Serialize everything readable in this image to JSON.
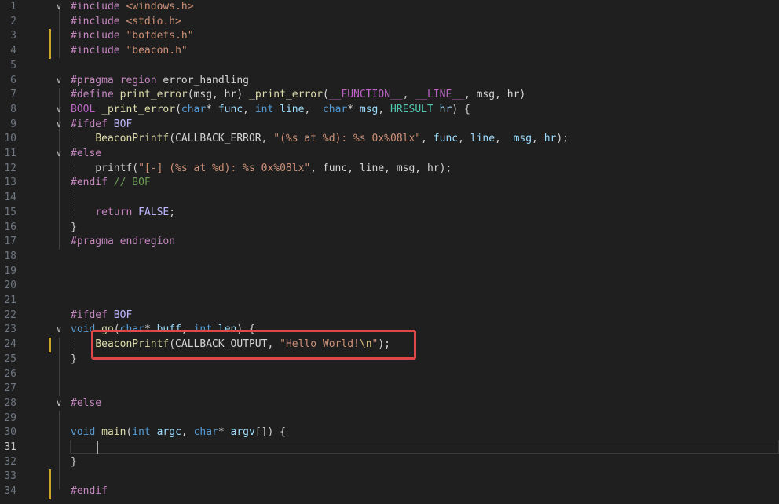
{
  "editor": {
    "active_line": 31,
    "colors": {
      "background": "#1f1f1f",
      "highlight_box": "#e04848",
      "modified_gutter": "#c8a628"
    },
    "lines": [
      {
        "n": "1",
        "fold": "v",
        "tokens": [
          {
            "t": "#include ",
            "c": "pp"
          },
          {
            "t": "<windows.h>",
            "c": "str"
          }
        ]
      },
      {
        "n": "2",
        "fold": "",
        "tokens": [
          {
            "t": "#include ",
            "c": "pp"
          },
          {
            "t": "<stdio.h>",
            "c": "str"
          }
        ]
      },
      {
        "n": "3",
        "fold": "",
        "mod": true,
        "tokens": [
          {
            "t": "#include ",
            "c": "pp"
          },
          {
            "t": "\"bofdefs.h\"",
            "c": "str"
          }
        ]
      },
      {
        "n": "4",
        "fold": "",
        "mod": true,
        "tokens": [
          {
            "t": "#include ",
            "c": "pp"
          },
          {
            "t": "\"beacon.h\"",
            "c": "str"
          }
        ]
      },
      {
        "n": "5",
        "fold": "",
        "tokens": []
      },
      {
        "n": "6",
        "fold": "v",
        "tokens": [
          {
            "t": "#pragma ",
            "c": "pp"
          },
          {
            "t": "region ",
            "c": "pp"
          },
          {
            "t": "error_handling",
            "c": "txt"
          }
        ]
      },
      {
        "n": "7",
        "fold": "",
        "tokens": [
          {
            "t": "#define ",
            "c": "pp"
          },
          {
            "t": "print_error",
            "c": "fn"
          },
          {
            "t": "(msg, hr) ",
            "c": "txt"
          },
          {
            "t": "_print_error",
            "c": "fn"
          },
          {
            "t": "(",
            "c": "txt"
          },
          {
            "t": "__FUNCTION__",
            "c": "mac"
          },
          {
            "t": ", ",
            "c": "txt"
          },
          {
            "t": "__LINE__",
            "c": "mac"
          },
          {
            "t": ", msg, hr)",
            "c": "txt"
          }
        ]
      },
      {
        "n": "8",
        "fold": "v",
        "tokens": [
          {
            "t": "BOOL ",
            "c": "mac"
          },
          {
            "t": "_print_error",
            "c": "fn"
          },
          {
            "t": "(",
            "c": "txt"
          },
          {
            "t": "char",
            "c": "kw"
          },
          {
            "t": "* ",
            "c": "txt"
          },
          {
            "t": "func",
            "c": "par"
          },
          {
            "t": ", ",
            "c": "txt"
          },
          {
            "t": "int ",
            "c": "kw"
          },
          {
            "t": "line",
            "c": "par"
          },
          {
            "t": ",  ",
            "c": "txt"
          },
          {
            "t": "char",
            "c": "kw"
          },
          {
            "t": "* ",
            "c": "txt"
          },
          {
            "t": "msg",
            "c": "par"
          },
          {
            "t": ", ",
            "c": "txt"
          },
          {
            "t": "HRESULT ",
            "c": "ty"
          },
          {
            "t": "hr",
            "c": "par"
          },
          {
            "t": ") {",
            "c": "txt"
          }
        ]
      },
      {
        "n": "9",
        "fold": "v",
        "tokens": [
          {
            "t": "#ifdef ",
            "c": "pp"
          },
          {
            "t": "BOF",
            "c": "mv"
          }
        ]
      },
      {
        "n": "10",
        "fold": "",
        "tokens": [
          {
            "t": "    ",
            "c": "txt"
          },
          {
            "t": "BeaconPrintf",
            "c": "fn"
          },
          {
            "t": "(CALLBACK_ERROR, ",
            "c": "txt"
          },
          {
            "t": "\"(%s at %d): %s 0x%08lx\"",
            "c": "str"
          },
          {
            "t": ", ",
            "c": "txt"
          },
          {
            "t": "func",
            "c": "par"
          },
          {
            "t": ", ",
            "c": "txt"
          },
          {
            "t": "line",
            "c": "par"
          },
          {
            "t": ",  ",
            "c": "txt"
          },
          {
            "t": "msg",
            "c": "par"
          },
          {
            "t": ", ",
            "c": "txt"
          },
          {
            "t": "hr",
            "c": "par"
          },
          {
            "t": ");",
            "c": "txt"
          }
        ]
      },
      {
        "n": "11",
        "fold": "v",
        "tokens": [
          {
            "t": "#else",
            "c": "pp"
          }
        ]
      },
      {
        "n": "12",
        "fold": "",
        "tokens": [
          {
            "t": "    printf(",
            "c": "txt"
          },
          {
            "t": "\"[-] (%s at %d): %s 0x%08lx\"",
            "c": "str"
          },
          {
            "t": ", func, line, msg, hr);",
            "c": "txt"
          }
        ]
      },
      {
        "n": "13",
        "fold": "",
        "tokens": [
          {
            "t": "#endif ",
            "c": "pp"
          },
          {
            "t": "// BOF",
            "c": "cm"
          }
        ]
      },
      {
        "n": "14",
        "fold": "",
        "tokens": []
      },
      {
        "n": "15",
        "fold": "",
        "tokens": [
          {
            "t": "    ",
            "c": "txt"
          },
          {
            "t": "return ",
            "c": "pp"
          },
          {
            "t": "FALSE",
            "c": "mv"
          },
          {
            "t": ";",
            "c": "txt"
          }
        ]
      },
      {
        "n": "16",
        "fold": "",
        "tokens": [
          {
            "t": "}",
            "c": "txt"
          }
        ]
      },
      {
        "n": "17",
        "fold": "",
        "tokens": [
          {
            "t": "#pragma ",
            "c": "pp"
          },
          {
            "t": "endregion",
            "c": "pp"
          }
        ]
      },
      {
        "n": "18",
        "fold": "",
        "tokens": []
      },
      {
        "n": "19",
        "fold": "",
        "tokens": []
      },
      {
        "n": "20",
        "fold": "",
        "tokens": []
      },
      {
        "n": "21",
        "fold": "",
        "tokens": []
      },
      {
        "n": "22",
        "fold": "",
        "tokens": [
          {
            "t": "#ifdef ",
            "c": "pp"
          },
          {
            "t": "BOF",
            "c": "mv"
          }
        ]
      },
      {
        "n": "23",
        "fold": "v",
        "tokens": [
          {
            "t": "void ",
            "c": "kw"
          },
          {
            "t": "go",
            "c": "fn"
          },
          {
            "t": "(",
            "c": "txt"
          },
          {
            "t": "char",
            "c": "kw"
          },
          {
            "t": "* ",
            "c": "txt"
          },
          {
            "t": "buff",
            "c": "par"
          },
          {
            "t": ", ",
            "c": "txt"
          },
          {
            "t": "int ",
            "c": "kw"
          },
          {
            "t": "len",
            "c": "par"
          },
          {
            "t": ") {",
            "c": "txt"
          }
        ]
      },
      {
        "n": "24",
        "fold": "",
        "mod": true,
        "tokens": [
          {
            "t": "    ",
            "c": "txt"
          },
          {
            "t": "BeaconPrintf",
            "c": "fn"
          },
          {
            "t": "(CALLBACK_OUTPUT, ",
            "c": "txt"
          },
          {
            "t": "\"Hello World!",
            "c": "str"
          },
          {
            "t": "\\n",
            "c": "esc"
          },
          {
            "t": "\"",
            "c": "str"
          },
          {
            "t": ");",
            "c": "txt"
          }
        ]
      },
      {
        "n": "25",
        "fold": "",
        "tokens": [
          {
            "t": "}",
            "c": "txt"
          }
        ]
      },
      {
        "n": "26",
        "fold": "",
        "tokens": []
      },
      {
        "n": "27",
        "fold": "",
        "tokens": []
      },
      {
        "n": "28",
        "fold": "v",
        "tokens": [
          {
            "t": "#else",
            "c": "pp"
          }
        ]
      },
      {
        "n": "29",
        "fold": "",
        "tokens": []
      },
      {
        "n": "30",
        "fold": "",
        "tokens": [
          {
            "t": "void ",
            "c": "kw"
          },
          {
            "t": "main",
            "c": "fn"
          },
          {
            "t": "(",
            "c": "txt"
          },
          {
            "t": "int ",
            "c": "kw"
          },
          {
            "t": "argc",
            "c": "par"
          },
          {
            "t": ", ",
            "c": "txt"
          },
          {
            "t": "char",
            "c": "kw"
          },
          {
            "t": "* ",
            "c": "txt"
          },
          {
            "t": "argv",
            "c": "par"
          },
          {
            "t": "[]) {",
            "c": "txt"
          }
        ]
      },
      {
        "n": "31",
        "fold": "",
        "tokens": []
      },
      {
        "n": "32",
        "fold": "",
        "tokens": [
          {
            "t": "}",
            "c": "txt"
          }
        ]
      },
      {
        "n": "33",
        "fold": "",
        "mod": true,
        "tokens": []
      },
      {
        "n": "34",
        "fold": "",
        "mod": true,
        "tokens": [
          {
            "t": "#endif",
            "c": "pp"
          }
        ]
      }
    ]
  }
}
